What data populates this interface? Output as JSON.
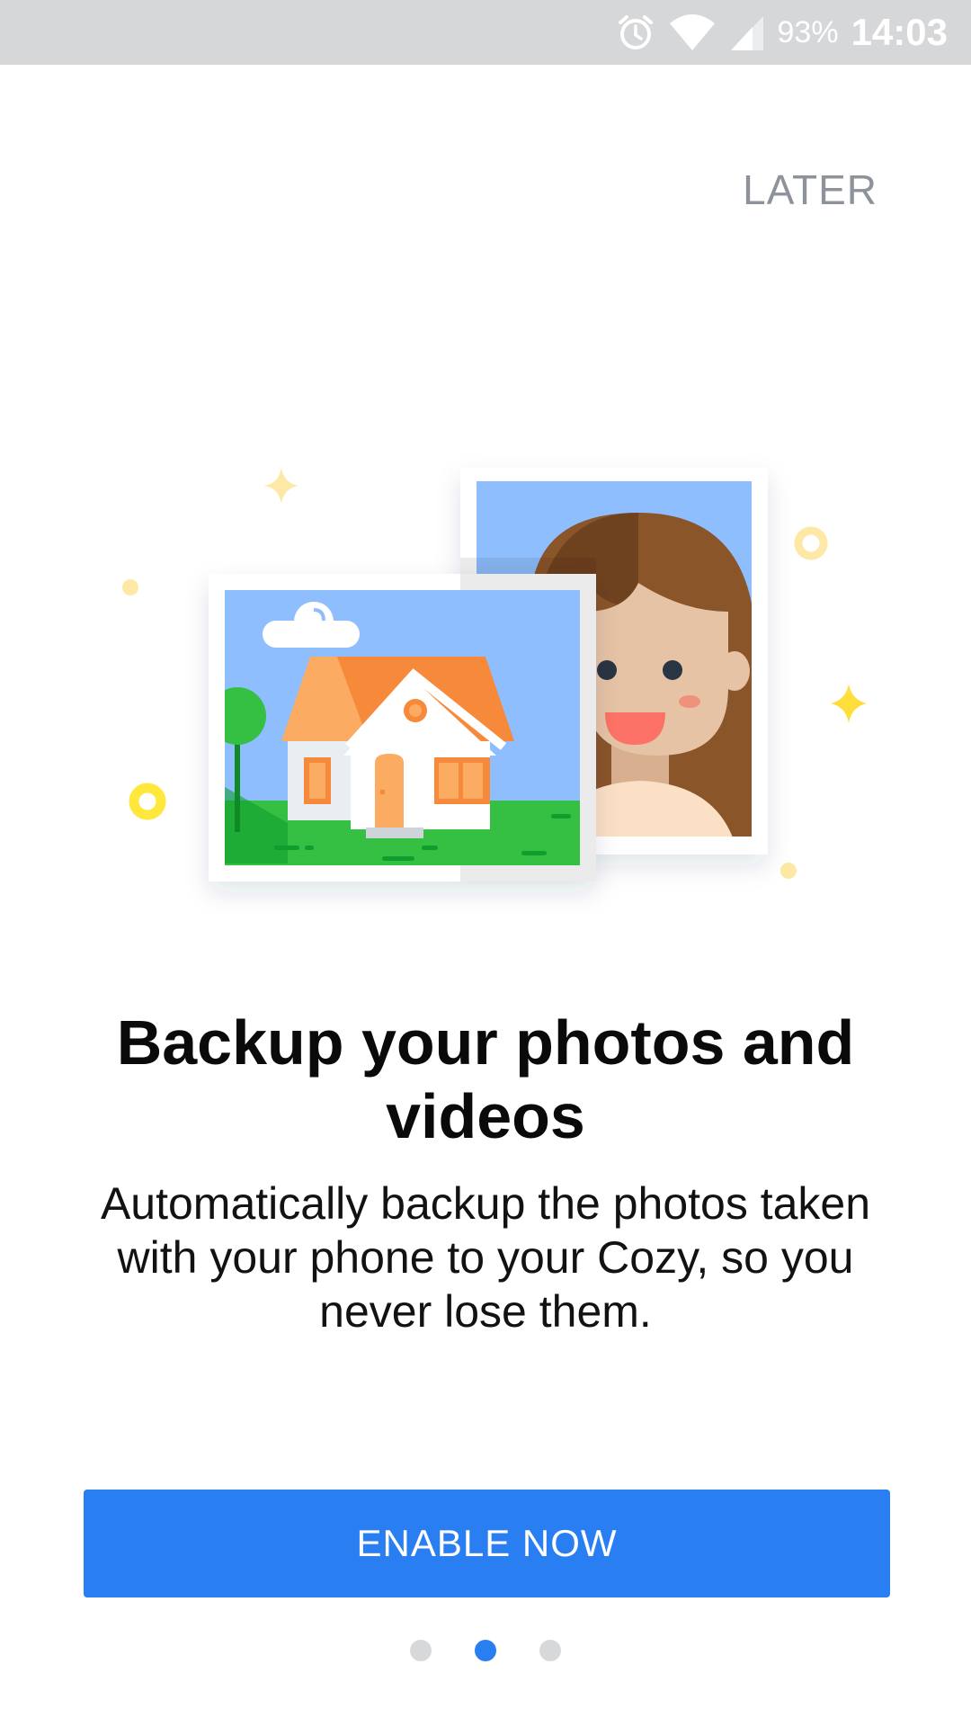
{
  "status_bar": {
    "battery": "93%",
    "time": "14:03",
    "icons": [
      "alarm-icon",
      "wifi-icon",
      "signal-icon"
    ]
  },
  "onboarding": {
    "later_label": "LATER",
    "title": "Backup your photos and videos",
    "description": "Automatically backup the photos taken with your phone to your Cozy, so you never lose them.",
    "enable_label": "ENABLE NOW",
    "pager": {
      "total": 3,
      "active_index": 1
    }
  },
  "colors": {
    "accent": "#297ef2",
    "status_bar": "#d6d7d9",
    "later_text": "#8e939b",
    "dot_inactive": "#d6d8da"
  }
}
